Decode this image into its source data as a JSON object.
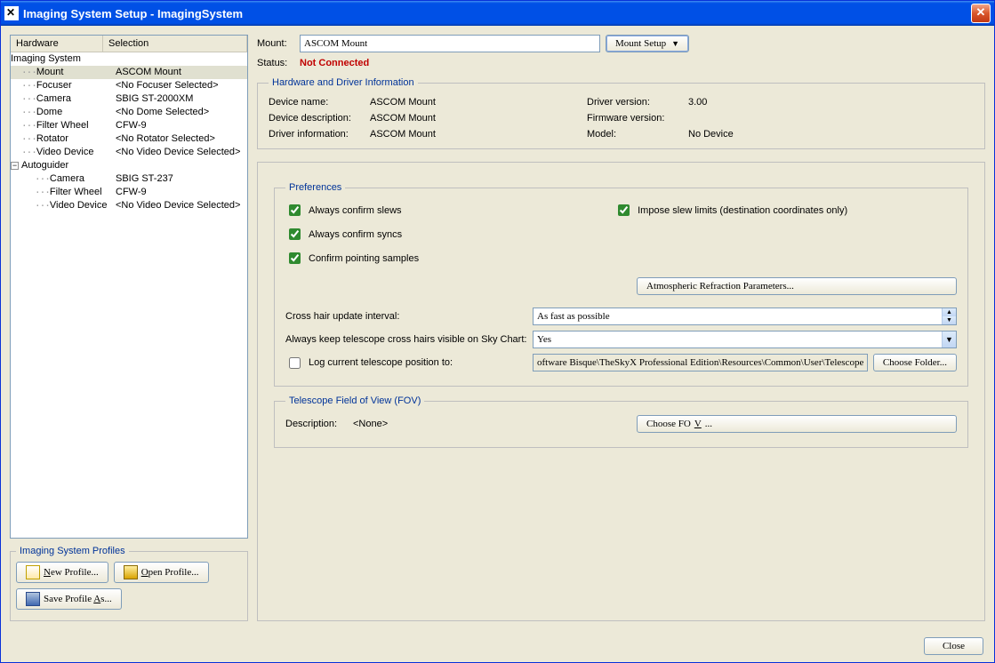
{
  "window": {
    "title": "Imaging System Setup - ImagingSystem"
  },
  "tree": {
    "header_hw": "Hardware",
    "header_sel": "Selection",
    "root": "Imaging System",
    "items": [
      {
        "hw": "Mount",
        "sel": "ASCOM Mount",
        "selected": true
      },
      {
        "hw": "Focuser",
        "sel": "<No Focuser Selected>"
      },
      {
        "hw": "Camera",
        "sel": "SBIG ST-2000XM"
      },
      {
        "hw": "Dome",
        "sel": "<No Dome Selected>"
      },
      {
        "hw": "Filter Wheel",
        "sel": "CFW-9"
      },
      {
        "hw": "Rotator",
        "sel": "<No Rotator Selected>"
      },
      {
        "hw": "Video Device",
        "sel": "<No Video Device Selected>"
      }
    ],
    "sub_root": "Autoguider",
    "sub_items": [
      {
        "hw": "Camera",
        "sel": "SBIG ST-237"
      },
      {
        "hw": "Filter Wheel",
        "sel": "CFW-9"
      },
      {
        "hw": "Video Device",
        "sel": "<No Video Device Selected>"
      }
    ]
  },
  "profiles": {
    "legend": "Imaging System Profiles",
    "new": "New Profile...",
    "open": "Open Profile...",
    "save": "Save Profile As..."
  },
  "form": {
    "mount_label": "Mount:",
    "mount_value": "ASCOM Mount",
    "mount_setup": "Mount Setup",
    "status_label": "Status:",
    "status_value": "Not Connected"
  },
  "hw_info": {
    "legend": "Hardware and Driver Information",
    "dev_name_l": "Device name:",
    "dev_name_v": "ASCOM Mount",
    "dev_desc_l": "Device description:",
    "dev_desc_v": "ASCOM Mount",
    "drv_info_l": "Driver information:",
    "drv_info_v": "ASCOM Mount",
    "drv_ver_l": "Driver version:",
    "drv_ver_v": "3.00",
    "fw_ver_l": "Firmware version:",
    "fw_ver_v": "",
    "model_l": "Model:",
    "model_v": "No Device"
  },
  "prefs": {
    "legend": "Preferences",
    "confirm_slews": "Always confirm slews",
    "confirm_syncs": "Always confirm syncs",
    "confirm_pointing": "Confirm pointing samples",
    "impose_limits": "Impose slew limits (destination coordinates only)",
    "atmos_btn": "Atmospheric Refraction Parameters...",
    "crosshair_l": "Cross hair update interval:",
    "crosshair_v": "As fast as possible",
    "keep_vis_l": "Always keep telescope cross hairs visible on Sky Chart:",
    "keep_vis_v": "Yes",
    "log_pos_l": "Log current telescope position to:",
    "log_pos_v": "oftware Bisque\\TheSkyX Professional Edition\\Resources\\Common\\User\\Telescope Position.txt",
    "choose_folder": "Choose Folder..."
  },
  "fov": {
    "legend": "Telescope Field of View (FOV)",
    "desc_l": "Description:",
    "desc_v": "<None>",
    "choose_fov": "Choose FOV..."
  },
  "close_btn": "Close"
}
